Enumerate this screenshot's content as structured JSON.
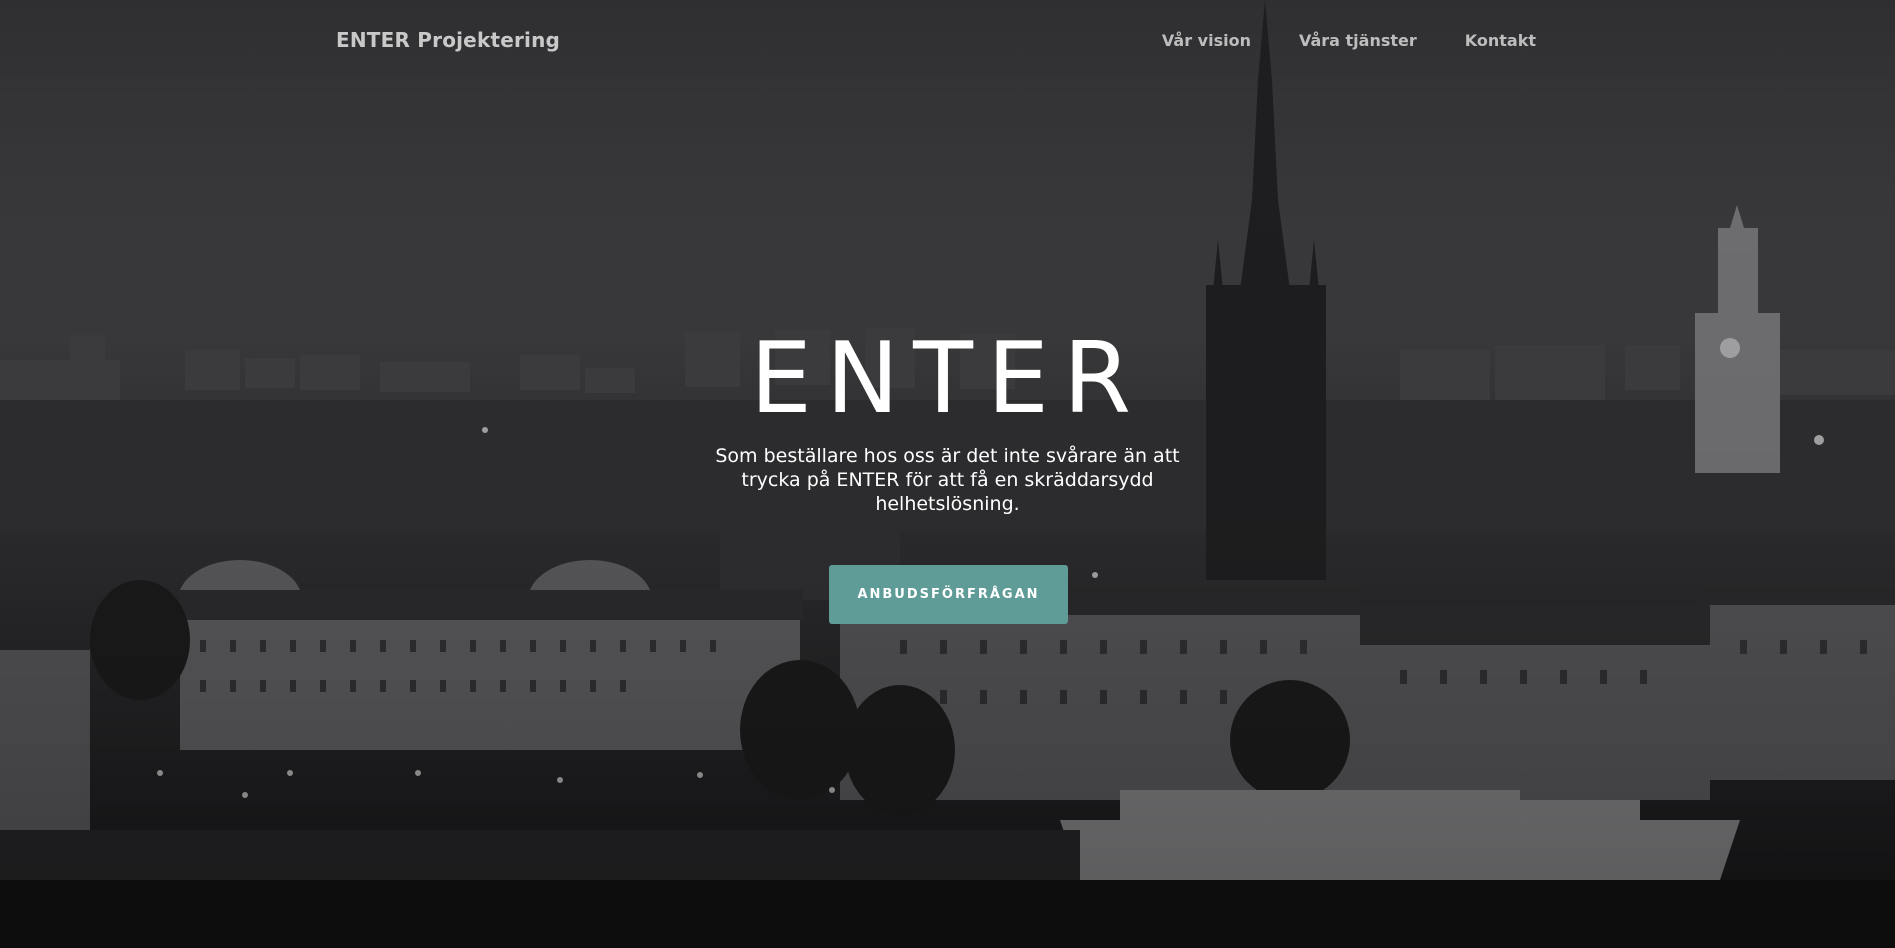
{
  "nav": {
    "brand": "ENTER Projektering",
    "links": [
      {
        "label": "Vår vision"
      },
      {
        "label": "Våra tjänster"
      },
      {
        "label": "Kontakt"
      }
    ]
  },
  "hero": {
    "headline": "ENTER",
    "tagline": "Som beställare hos oss är det inte svårare än att trycka på ENTER för att få en skräddarsydd helhetslösning.",
    "cta_label": "ANBUDSFÖRFRÅGAN",
    "background": "night-city-skyline-photo"
  },
  "colors": {
    "accent": "#5f9c98",
    "text": "#ffffff",
    "nav_text": "#bdbdbd",
    "background": "#2b2b2d"
  }
}
